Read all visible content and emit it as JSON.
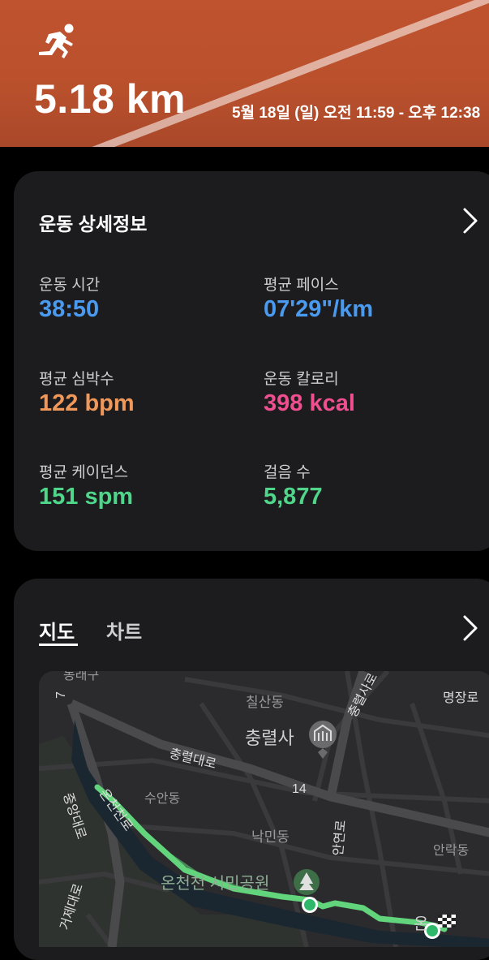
{
  "hero": {
    "distance": "5.18 km",
    "datetime": "5월 18일 (일) 오전 11:59 - 오후 12:38",
    "icon": "running-icon"
  },
  "details": {
    "title": "운동 상세정보",
    "stats": [
      {
        "label": "운동 시간",
        "value": "38:50",
        "color": "#4a9bf0"
      },
      {
        "label": "평균 페이스",
        "value": "07'29\"/km",
        "color": "#4a9bf0"
      },
      {
        "label": "평균 심박수",
        "value": "122 bpm",
        "color": "#f0975a"
      },
      {
        "label": "운동 칼로리",
        "value": "398 kcal",
        "color": "#ef4f8f"
      },
      {
        "label": "평균 케이던스",
        "value": "151 spm",
        "color": "#4fd68a"
      },
      {
        "label": "걸음 수",
        "value": "5,877",
        "color": "#4fd68a"
      }
    ]
  },
  "map_card": {
    "tabs": [
      "지도",
      "차트"
    ],
    "active_tab": "지도",
    "map_labels": {
      "l1": "동래구",
      "l2": "칠산동",
      "l3": "명장로",
      "l4": "충렬사",
      "l5": "충렬대로",
      "l6": "충렬사로",
      "l7": "수안동",
      "l8": "14",
      "l9": "온천천로",
      "l10": "중앙대로",
      "l11": "낙민동",
      "l12": "안연로",
      "l13": "안락동",
      "l14": "온천천 시민공원",
      "l15": "거제대로",
      "l16": "7",
      "l17": "온"
    },
    "route_color": "#62d47c"
  }
}
